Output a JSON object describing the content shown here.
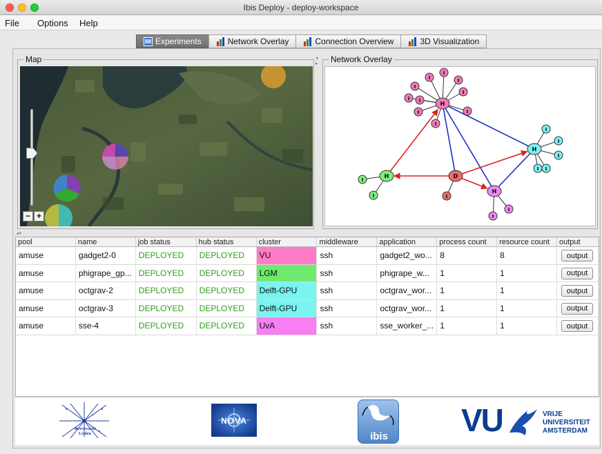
{
  "window": {
    "title": "Ibis Deploy - deploy-workspace"
  },
  "menu": [
    "File",
    "Options",
    "Help"
  ],
  "tabs": [
    {
      "label": "Experiments",
      "active": true
    },
    {
      "label": "Network Overlay",
      "active": false
    },
    {
      "label": "Connection Overview",
      "active": false
    },
    {
      "label": "3D Visualization",
      "active": false
    }
  ],
  "map": {
    "title": "Map",
    "zoom_minus": "−",
    "zoom_plus": "+"
  },
  "overlay": {
    "title": "Network Overlay",
    "node_labels": {
      "hub": "H",
      "instance": "I",
      "deploy": "D"
    }
  },
  "table": {
    "columns": [
      "pool",
      "name",
      "job status",
      "hub status",
      "cluster",
      "middleware",
      "application",
      "process count",
      "resource count",
      "output"
    ],
    "rows": [
      {
        "pool": "amuse",
        "name": "gadget2-0",
        "job_status": "DEPLOYED",
        "hub_status": "DEPLOYED",
        "cluster": "VU",
        "cluster_color": "#ff7bc7",
        "middleware": "ssh",
        "application": "gadget2_wo...",
        "process_count": "8",
        "resource_count": "8",
        "output": "output"
      },
      {
        "pool": "amuse",
        "name": "phigrape_gp...",
        "job_status": "DEPLOYED",
        "hub_status": "DEPLOYED",
        "cluster": "LGM",
        "cluster_color": "#6fea6f",
        "middleware": "ssh",
        "application": "phigrape_w...",
        "process_count": "1",
        "resource_count": "1",
        "output": "output"
      },
      {
        "pool": "amuse",
        "name": "octgrav-2",
        "job_status": "DEPLOYED",
        "hub_status": "DEPLOYED",
        "cluster": "Delft-GPU",
        "cluster_color": "#79f4f0",
        "middleware": "ssh",
        "application": "octgrav_wor...",
        "process_count": "1",
        "resource_count": "1",
        "output": "output"
      },
      {
        "pool": "amuse",
        "name": "octgrav-3",
        "job_status": "DEPLOYED",
        "hub_status": "DEPLOYED",
        "cluster": "Delft-GPU",
        "cluster_color": "#79f4f0",
        "middleware": "ssh",
        "application": "octgrav_wor...",
        "process_count": "1",
        "resource_count": "1",
        "output": "output"
      },
      {
        "pool": "amuse",
        "name": "sse-4",
        "job_status": "DEPLOYED",
        "hub_status": "DEPLOYED",
        "cluster": "UvA",
        "cluster_color": "#f77ff3",
        "middleware": "ssh",
        "application": "sse_worker_...",
        "process_count": "1",
        "resource_count": "1",
        "output": "output"
      }
    ]
  },
  "logos": {
    "leiden": "Sterrewacht Leiden",
    "nova": "NOVA",
    "ibis": "ibis",
    "vu_mark": "VU",
    "vu_line1": "VRIJE",
    "vu_line2": "UNIVERSITEIT",
    "vu_line3": "AMSTERDAM"
  },
  "colors": {
    "status_ok": "#2f9d1a",
    "pink_node": "#f07ab8",
    "cyan_node": "#7af0f0",
    "green_node": "#7eef7e",
    "red_node": "#f06a6a",
    "magenta_node": "#ee88ee",
    "edge_red": "#e02020",
    "edge_blue": "#2030c8"
  }
}
